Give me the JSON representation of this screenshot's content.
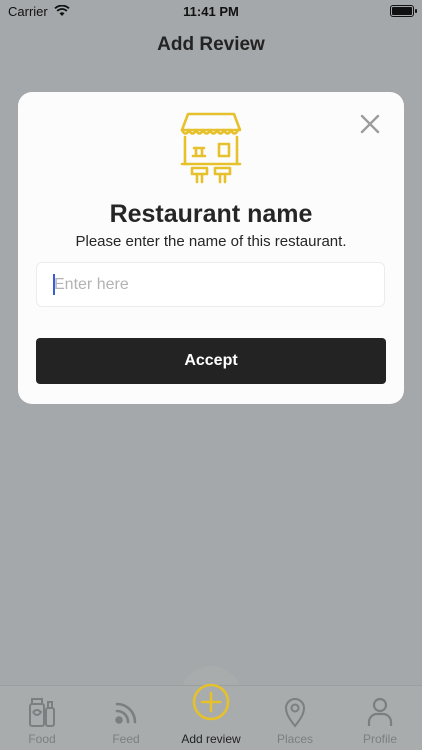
{
  "status_bar": {
    "carrier": "Carrier",
    "time": "11:41 PM"
  },
  "nav": {
    "title": "Add Review"
  },
  "modal": {
    "title": "Restaurant name",
    "subtitle": "Please enter the name of this restaurant.",
    "input": {
      "placeholder": "Enter here",
      "value": ""
    },
    "accept_label": "Accept"
  },
  "tabs": [
    {
      "label": "Food",
      "icon": "food-icon"
    },
    {
      "label": "Feed",
      "icon": "feed-icon"
    },
    {
      "label": "Add review",
      "icon": "plus-circle-icon",
      "active": true
    },
    {
      "label": "Places",
      "icon": "location-pin-icon"
    },
    {
      "label": "Profile",
      "icon": "person-icon"
    }
  ],
  "colors": {
    "accent": "#e6c12c",
    "dark": "#232323",
    "overlay": "#a4a8aa"
  }
}
